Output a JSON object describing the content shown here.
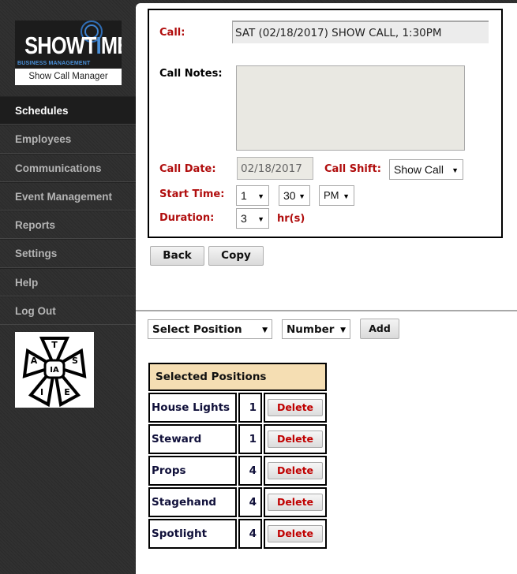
{
  "logo": {
    "brand_prefix": "SHOWT",
    "brand_i": "I",
    "brand_suffix": "ME",
    "tagline": "BUSINESS MANAGEMENT",
    "caption": "Show Call Manager"
  },
  "sidebar": {
    "items": [
      {
        "label": "Schedules",
        "active": true
      },
      {
        "label": "Employees"
      },
      {
        "label": "Communications"
      },
      {
        "label": "Event Management"
      },
      {
        "label": "Reports"
      },
      {
        "label": "Settings"
      },
      {
        "label": "Help"
      },
      {
        "label": "Log Out"
      }
    ],
    "union_logo": {
      "letters": [
        "T",
        "S",
        "E",
        "I",
        "A"
      ],
      "center": "IA"
    }
  },
  "form": {
    "call_label": "Call:",
    "call_value": "SAT (02/18/2017) SHOW CALL, 1:30PM",
    "notes_label": "Call Notes:",
    "notes_value": "",
    "date_label": "Call Date:",
    "date_value": "02/18/2017",
    "shift_label": "Call Shift:",
    "shift_value": "Show Call",
    "start_label": "Start Time:",
    "start_hour": "1",
    "start_minute": "30",
    "start_ampm": "PM",
    "duration_label": "Duration:",
    "duration_value": "3",
    "duration_unit": "hr(s)"
  },
  "actions": {
    "back_label": "Back",
    "copy_label": "Copy"
  },
  "add_position": {
    "position_select": "Select Position",
    "number_select": "Number",
    "add_label": "Add"
  },
  "positions": {
    "header": "Selected Positions",
    "delete_label": "Delete",
    "rows": [
      {
        "name": "House Lights",
        "count": "1"
      },
      {
        "name": "Steward",
        "count": "1"
      },
      {
        "name": "Props",
        "count": "4"
      },
      {
        "name": "Stagehand",
        "count": "4"
      },
      {
        "name": "Spotlight",
        "count": "4"
      }
    ]
  },
  "colors": {
    "label_red": "#b00d0d",
    "header_bg": "#f5deb3",
    "delete_red": "#c00000",
    "brand_blue": "#4a90d9"
  },
  "icons": {
    "dropdown": "▼"
  }
}
